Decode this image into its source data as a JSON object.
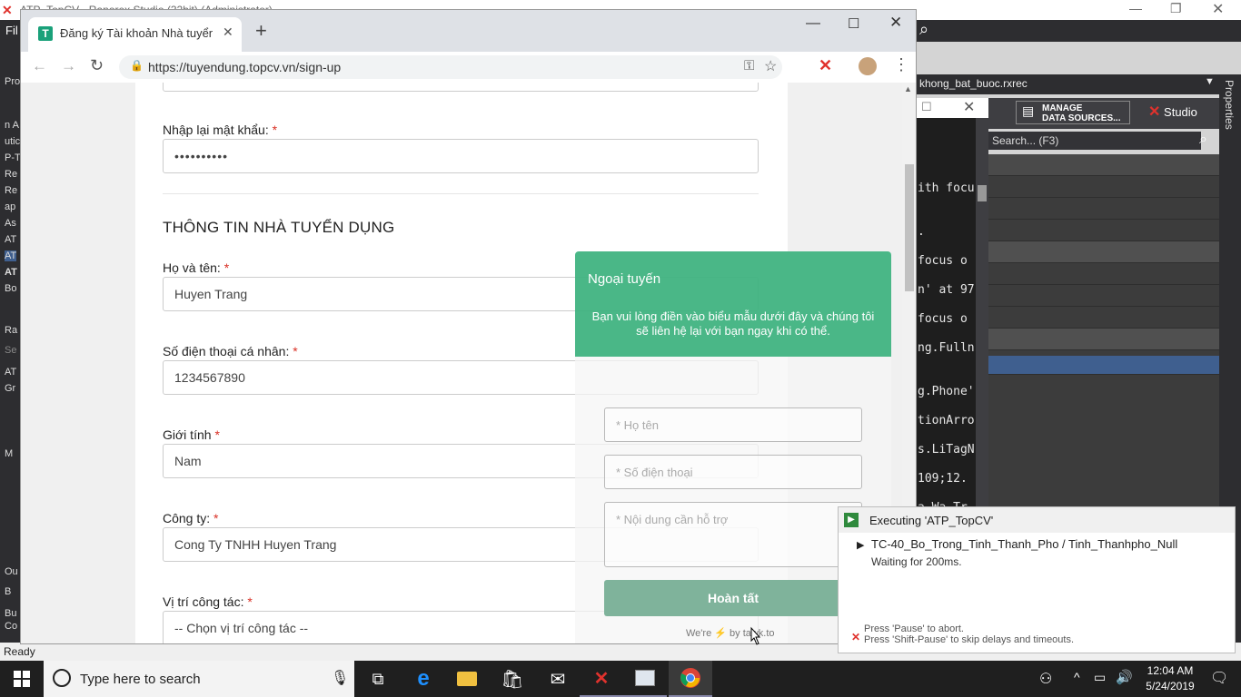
{
  "studio": {
    "title": "ATP_TopCV - Ranorex Studio (32bit) (Administrator)",
    "menu_file": "Fil",
    "left_panel": [
      "Pro",
      "n A",
      "utic",
      "P-T",
      "Re",
      "Re",
      "ap",
      "As",
      "AT",
      "AT",
      "AT",
      "Bo",
      "Ra",
      "Se",
      "AT",
      "Gr",
      "M",
      "Ou",
      "B",
      "Bu",
      "Co"
    ],
    "tab_file": "khong_bat_buoc.rxrec",
    "manage_label_1": "MANAGE",
    "manage_label_2": "DATA SOURCES...",
    "studio_label": "Studio",
    "search_placeholder": "Search... (F3)",
    "properties_label": "Properties",
    "status": "Ready",
    "code_lines": [
      "ith focu",
      ".",
      "focus o",
      "n' at 97",
      "focus o",
      "ng.Fulln",
      "g.Phone'",
      "tionArro",
      "s.LiTagN",
      "109;12.",
      "a Wa Tr"
    ]
  },
  "chrome": {
    "tab_title": "Đăng ký Tài khoản Nhà tuyển dụ",
    "tab_favicon": "T",
    "url": "https://tuyendung.topcv.vn/sign-up"
  },
  "form": {
    "repassword_label": "Nhập lại mật khẩu:",
    "repassword_value": "••••••••••",
    "section_title": "THÔNG TIN NHÀ TUYỂN DỤNG",
    "fullname_label": "Họ và tên:",
    "fullname_value": "Huyen Trang",
    "phone_label": "Số điện thoại cá nhân:",
    "phone_value": "1234567890",
    "gender_label": "Giới tính",
    "gender_value": "Nam",
    "company_label": "Công ty:",
    "company_value": "Cong Ty TNHH Huyen Trang",
    "position_label": "Vị trí công tác:",
    "position_value": "-- Chọn vị trí công tác --",
    "required_mark": "*"
  },
  "chat": {
    "status": "Ngoại tuyến",
    "message": "Bạn vui lòng điền vào biểu mẫu dưới đây và chúng tôi sẽ liên hệ lại với bạn ngay khi có thể.",
    "name_placeholder": "* Họ tên",
    "phone_placeholder": "* Số điện thoại",
    "content_placeholder": "* Nội dung cần hỗ trợ",
    "submit": "Hoàn tất",
    "powered_prefix": "We're",
    "powered_by": "by tawk.to"
  },
  "exec": {
    "title": "Executing 'ATP_TopCV'",
    "testcase": "TC-40_Bo_Trong_Tinh_Thanh_Pho / Tinh_Thanhpho_Null",
    "waiting": "Waiting for 200ms.",
    "hint1": "Press 'Pause' to abort.",
    "hint2": "Press 'Shift-Pause' to skip delays and timeouts."
  },
  "taskbar": {
    "search_placeholder": "Type here to search",
    "time": "12:04 AM",
    "date": "5/24/2019"
  },
  "colors": {
    "chat_green": "#3fb27f",
    "chrome_tab_bar": "#dee1e6",
    "taskbar": "#1f1f1f"
  }
}
